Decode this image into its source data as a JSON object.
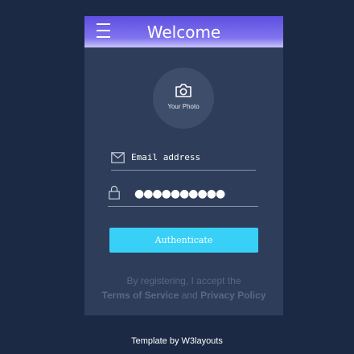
{
  "header": {
    "title": "Welcome",
    "menu_icon": "menu-icon"
  },
  "photo": {
    "label": "Your Photo",
    "icon": "camera-icon"
  },
  "email": {
    "icon": "mail-icon",
    "placeholder": "Email address"
  },
  "password": {
    "icon": "lock-icon",
    "masked_value": "●●●●●●●●●●"
  },
  "auth_button": {
    "label": "Authenticate"
  },
  "terms": {
    "prefix": "By registering, I accept the",
    "tos": "Terms of Service",
    "and": "and",
    "privacy": "Privacy Policy"
  },
  "footer": {
    "text": "Template by W3layouts"
  },
  "colors": {
    "background": "#1c2944",
    "card": "#2e3d59",
    "header_top": "#5e4fe0",
    "button": "#38d0f6"
  }
}
